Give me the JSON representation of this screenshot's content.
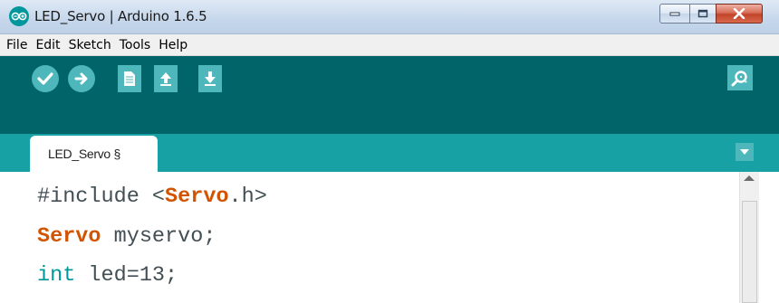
{
  "window": {
    "title": "LED_Servo | Arduino 1.6.5",
    "controls": {
      "minimize": "minimize",
      "maximize": "maximize",
      "close": "close"
    }
  },
  "menu": {
    "items": [
      "File",
      "Edit",
      "Sketch",
      "Tools",
      "Help"
    ]
  },
  "toolbar": {
    "buttons": [
      {
        "name": "verify",
        "icon": "check-icon"
      },
      {
        "name": "upload",
        "icon": "arrow-right-icon"
      },
      {
        "name": "new",
        "icon": "document-icon"
      },
      {
        "name": "open",
        "icon": "arrow-up-icon"
      },
      {
        "name": "save",
        "icon": "arrow-down-icon"
      }
    ],
    "serial_monitor_icon": "magnifier-icon"
  },
  "tabs": {
    "active_label": "LED_Servo §",
    "menu_icon": "triangle-down-icon"
  },
  "editor": {
    "lines": [
      {
        "parts": [
          {
            "text": "#include <",
            "style": "plain"
          },
          {
            "text": "Servo",
            "style": "class"
          },
          {
            "text": ".h>",
            "style": "plain"
          }
        ]
      },
      {
        "parts": [
          {
            "text": "Servo",
            "style": "class"
          },
          {
            "text": " myservo;",
            "style": "plain"
          }
        ]
      },
      {
        "parts": [
          {
            "text": "int",
            "style": "type"
          },
          {
            "text": " led=13;",
            "style": "plain"
          }
        ]
      }
    ]
  },
  "colors": {
    "toolbar": "#006468",
    "tabstrip": "#17a1a5",
    "button": "#4db7bb",
    "keyword_class": "#d35400",
    "keyword_type": "#00979c",
    "code_text": "#434f54"
  }
}
